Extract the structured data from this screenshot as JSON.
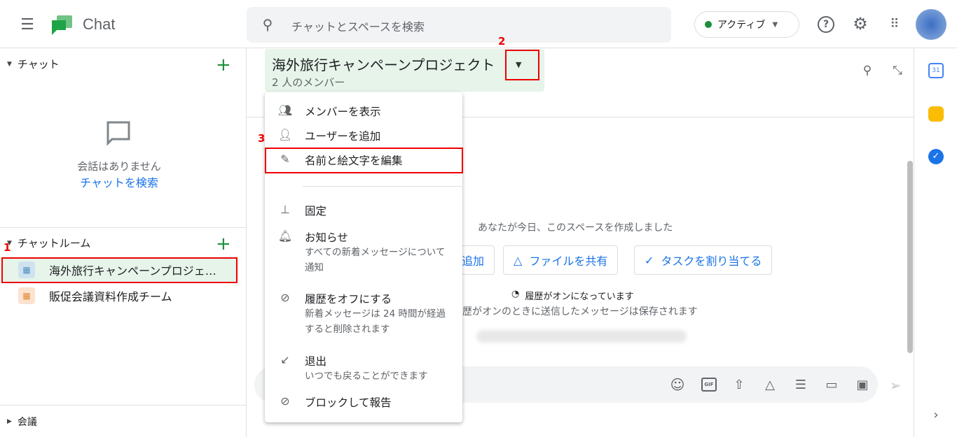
{
  "header": {
    "app_name": "Chat",
    "search_placeholder": "チャットとスペースを検索",
    "status": "アクティブ",
    "status_color": "#1e8e3e"
  },
  "sidebar": {
    "chat_section": "チャット",
    "empty_text": "会話はありません",
    "search_link": "チャットを検索",
    "rooms_section": "チャットルーム",
    "rooms": [
      {
        "name": "海外旅行キャンペーンプロジェ…",
        "selected": true
      },
      {
        "name": "販促会議資料作成チーム",
        "selected": false
      }
    ],
    "meetings_section": "会議"
  },
  "space": {
    "title": "海外旅行キャンペーンプロジェクト",
    "members": "2 人のメンバー",
    "created_text": "あなたが今日、このスペースを作成しました",
    "chips": [
      "追加",
      "ファイルを共有",
      "タスクを割り当てる"
    ],
    "history_on": "履歴がオンになっています",
    "history_desc": "歴がオンのときに送信したメッセージは保存されます"
  },
  "menu": {
    "items": [
      {
        "icon": "people-icon",
        "label": "メンバーを表示"
      },
      {
        "icon": "add-person-icon",
        "label": "ユーザーを追加"
      },
      {
        "icon": "pencil-icon",
        "label": "名前と絵文字を編集"
      },
      {
        "icon": "pin-icon",
        "label": "固定"
      },
      {
        "icon": "bell-icon",
        "label": "お知らせ",
        "sub": "すべての新着メッセージについて通知"
      },
      {
        "icon": "history-off-icon",
        "label": "履歴をオフにする",
        "sub": "新着メッセージは 24 時間が経過すると削除されます"
      },
      {
        "icon": "exit-icon",
        "label": "退出",
        "sub": "いつでも戻ることができます"
      },
      {
        "icon": "block-icon",
        "label": "ブロックして報告"
      }
    ]
  },
  "annotations": [
    "1",
    "2",
    "3"
  ],
  "accent_color": "#1a73e8",
  "annotation_color": "#ee0000"
}
